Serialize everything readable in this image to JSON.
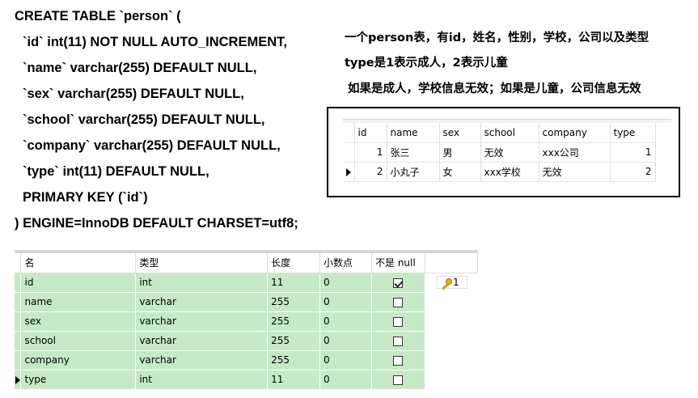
{
  "sql": {
    "lines": [
      "CREATE TABLE `person` (",
      "`id` int(11) NOT NULL AUTO_INCREMENT,",
      "`name` varchar(255) DEFAULT NULL,",
      "`sex` varchar(255) DEFAULT NULL,",
      "`school` varchar(255) DEFAULT NULL,",
      "`company` varchar(255) DEFAULT NULL,",
      "`type` int(11) DEFAULT NULL,",
      "PRIMARY KEY (`id`)",
      ") ENGINE=InnoDB DEFAULT CHARSET=utf8;"
    ]
  },
  "description": {
    "line1": "一个person表，有id，姓名，性别，学校，公司以及类型",
    "line2": "type是1表示成人，2表示儿童",
    "line3": "如果是成人，学校信息无效；如果是儿童，公司信息无效"
  },
  "data_grid": {
    "headers": [
      "id",
      "name",
      "sex",
      "school",
      "company",
      "type"
    ],
    "selected_header": "company",
    "rows": [
      {
        "id": "1",
        "name": "张三",
        "sex": "男",
        "school": "无效",
        "company": "xxx公司",
        "type": "1",
        "current": false
      },
      {
        "id": "2",
        "name": "小丸子",
        "sex": "女",
        "school": "xxx学校",
        "company": "无效",
        "type": "2",
        "current": true
      }
    ]
  },
  "design_table": {
    "headers": [
      "名",
      "类型",
      "长度",
      "小数点",
      "不是 null",
      ""
    ],
    "rows": [
      {
        "name": "id",
        "type": "int",
        "length": "11",
        "decimals": "0",
        "not_null": true,
        "key": "1"
      },
      {
        "name": "name",
        "type": "varchar",
        "length": "255",
        "decimals": "0",
        "not_null": false,
        "key": ""
      },
      {
        "name": "sex",
        "type": "varchar",
        "length": "255",
        "decimals": "0",
        "not_null": false,
        "key": ""
      },
      {
        "name": "school",
        "type": "varchar",
        "length": "255",
        "decimals": "0",
        "not_null": false,
        "key": ""
      },
      {
        "name": "company",
        "type": "varchar",
        "length": "255",
        "decimals": "0",
        "not_null": false,
        "key": ""
      },
      {
        "name": "type",
        "type": "int",
        "length": "11",
        "decimals": "0",
        "not_null": false,
        "key": "",
        "current": true
      }
    ],
    "key_icon": "key-icon",
    "colors": {
      "row_bg": "#c6eac6",
      "selected_header": "#d6e8f7"
    }
  }
}
